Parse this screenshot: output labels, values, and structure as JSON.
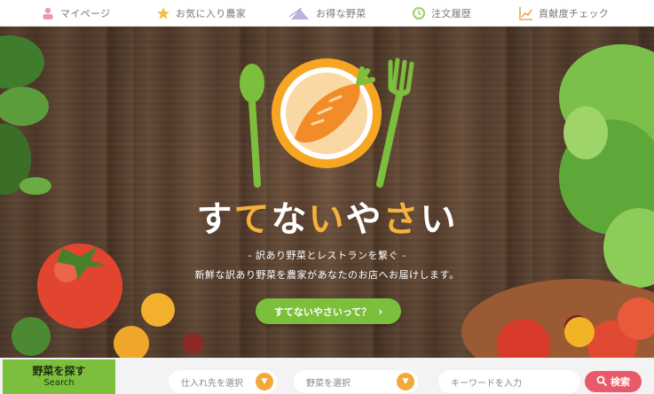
{
  "nav": {
    "items": [
      {
        "label": "マイページ",
        "icon": "person-icon"
      },
      {
        "label": "お気に入り農家",
        "icon": "star-icon"
      },
      {
        "label": "お得な野菜",
        "icon": "price-tag-icon"
      },
      {
        "label": "注文履歴",
        "icon": "history-icon"
      },
      {
        "label": "貢献度チェック",
        "icon": "chart-icon"
      }
    ]
  },
  "hero": {
    "brand_chars": [
      "す",
      "て",
      "な",
      "い",
      "や",
      "さ",
      "い"
    ],
    "tagline": "- 訳あり野菜とレストランを繋ぐ -",
    "subline": "新鮮な訳あり野菜を農家があなたのお店へお届けします。",
    "about_button": "すてないやさいって？"
  },
  "search": {
    "tab_title": "野菜を探す",
    "tab_sub": "Search",
    "supplier_select": "仕入れ先を選択",
    "vegetable_select": "野菜を選択",
    "keyword_placeholder": "キーワードを入力",
    "search_button": "検索"
  },
  "colors": {
    "accent_green": "#7cbf3c",
    "accent_orange": "#f3a83a",
    "search_red": "#e85a6a"
  }
}
